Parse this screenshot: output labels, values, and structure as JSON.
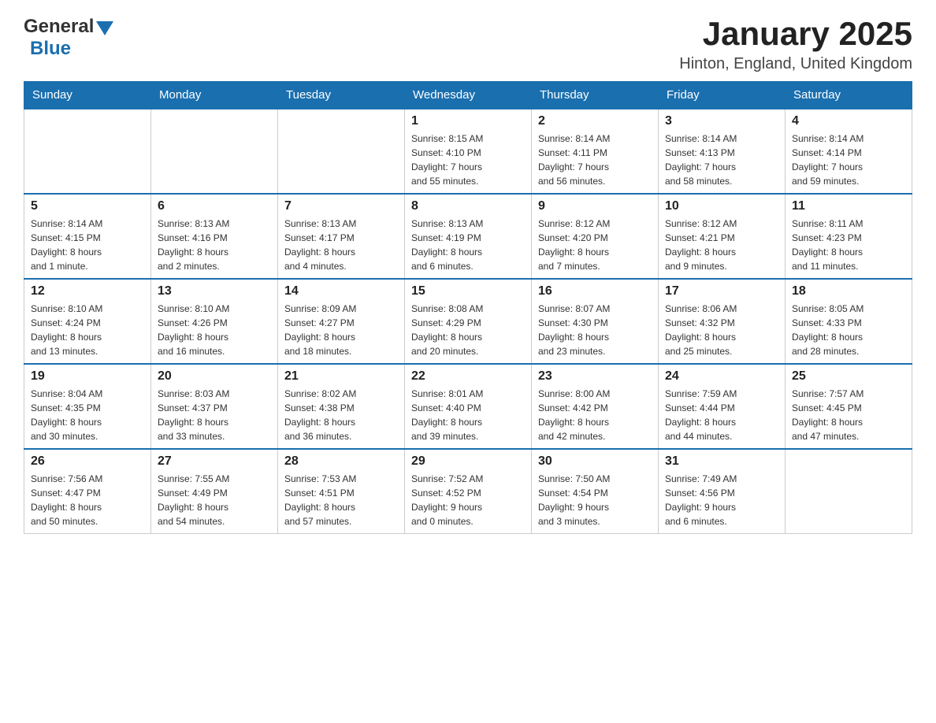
{
  "header": {
    "logo_text_general": "General",
    "logo_text_blue": "Blue",
    "title": "January 2025",
    "subtitle": "Hinton, England, United Kingdom"
  },
  "days_of_week": [
    "Sunday",
    "Monday",
    "Tuesday",
    "Wednesday",
    "Thursday",
    "Friday",
    "Saturday"
  ],
  "weeks": [
    [
      {
        "day": "",
        "info": ""
      },
      {
        "day": "",
        "info": ""
      },
      {
        "day": "",
        "info": ""
      },
      {
        "day": "1",
        "info": "Sunrise: 8:15 AM\nSunset: 4:10 PM\nDaylight: 7 hours\nand 55 minutes."
      },
      {
        "day": "2",
        "info": "Sunrise: 8:14 AM\nSunset: 4:11 PM\nDaylight: 7 hours\nand 56 minutes."
      },
      {
        "day": "3",
        "info": "Sunrise: 8:14 AM\nSunset: 4:13 PM\nDaylight: 7 hours\nand 58 minutes."
      },
      {
        "day": "4",
        "info": "Sunrise: 8:14 AM\nSunset: 4:14 PM\nDaylight: 7 hours\nand 59 minutes."
      }
    ],
    [
      {
        "day": "5",
        "info": "Sunrise: 8:14 AM\nSunset: 4:15 PM\nDaylight: 8 hours\nand 1 minute."
      },
      {
        "day": "6",
        "info": "Sunrise: 8:13 AM\nSunset: 4:16 PM\nDaylight: 8 hours\nand 2 minutes."
      },
      {
        "day": "7",
        "info": "Sunrise: 8:13 AM\nSunset: 4:17 PM\nDaylight: 8 hours\nand 4 minutes."
      },
      {
        "day": "8",
        "info": "Sunrise: 8:13 AM\nSunset: 4:19 PM\nDaylight: 8 hours\nand 6 minutes."
      },
      {
        "day": "9",
        "info": "Sunrise: 8:12 AM\nSunset: 4:20 PM\nDaylight: 8 hours\nand 7 minutes."
      },
      {
        "day": "10",
        "info": "Sunrise: 8:12 AM\nSunset: 4:21 PM\nDaylight: 8 hours\nand 9 minutes."
      },
      {
        "day": "11",
        "info": "Sunrise: 8:11 AM\nSunset: 4:23 PM\nDaylight: 8 hours\nand 11 minutes."
      }
    ],
    [
      {
        "day": "12",
        "info": "Sunrise: 8:10 AM\nSunset: 4:24 PM\nDaylight: 8 hours\nand 13 minutes."
      },
      {
        "day": "13",
        "info": "Sunrise: 8:10 AM\nSunset: 4:26 PM\nDaylight: 8 hours\nand 16 minutes."
      },
      {
        "day": "14",
        "info": "Sunrise: 8:09 AM\nSunset: 4:27 PM\nDaylight: 8 hours\nand 18 minutes."
      },
      {
        "day": "15",
        "info": "Sunrise: 8:08 AM\nSunset: 4:29 PM\nDaylight: 8 hours\nand 20 minutes."
      },
      {
        "day": "16",
        "info": "Sunrise: 8:07 AM\nSunset: 4:30 PM\nDaylight: 8 hours\nand 23 minutes."
      },
      {
        "day": "17",
        "info": "Sunrise: 8:06 AM\nSunset: 4:32 PM\nDaylight: 8 hours\nand 25 minutes."
      },
      {
        "day": "18",
        "info": "Sunrise: 8:05 AM\nSunset: 4:33 PM\nDaylight: 8 hours\nand 28 minutes."
      }
    ],
    [
      {
        "day": "19",
        "info": "Sunrise: 8:04 AM\nSunset: 4:35 PM\nDaylight: 8 hours\nand 30 minutes."
      },
      {
        "day": "20",
        "info": "Sunrise: 8:03 AM\nSunset: 4:37 PM\nDaylight: 8 hours\nand 33 minutes."
      },
      {
        "day": "21",
        "info": "Sunrise: 8:02 AM\nSunset: 4:38 PM\nDaylight: 8 hours\nand 36 minutes."
      },
      {
        "day": "22",
        "info": "Sunrise: 8:01 AM\nSunset: 4:40 PM\nDaylight: 8 hours\nand 39 minutes."
      },
      {
        "day": "23",
        "info": "Sunrise: 8:00 AM\nSunset: 4:42 PM\nDaylight: 8 hours\nand 42 minutes."
      },
      {
        "day": "24",
        "info": "Sunrise: 7:59 AM\nSunset: 4:44 PM\nDaylight: 8 hours\nand 44 minutes."
      },
      {
        "day": "25",
        "info": "Sunrise: 7:57 AM\nSunset: 4:45 PM\nDaylight: 8 hours\nand 47 minutes."
      }
    ],
    [
      {
        "day": "26",
        "info": "Sunrise: 7:56 AM\nSunset: 4:47 PM\nDaylight: 8 hours\nand 50 minutes."
      },
      {
        "day": "27",
        "info": "Sunrise: 7:55 AM\nSunset: 4:49 PM\nDaylight: 8 hours\nand 54 minutes."
      },
      {
        "day": "28",
        "info": "Sunrise: 7:53 AM\nSunset: 4:51 PM\nDaylight: 8 hours\nand 57 minutes."
      },
      {
        "day": "29",
        "info": "Sunrise: 7:52 AM\nSunset: 4:52 PM\nDaylight: 9 hours\nand 0 minutes."
      },
      {
        "day": "30",
        "info": "Sunrise: 7:50 AM\nSunset: 4:54 PM\nDaylight: 9 hours\nand 3 minutes."
      },
      {
        "day": "31",
        "info": "Sunrise: 7:49 AM\nSunset: 4:56 PM\nDaylight: 9 hours\nand 6 minutes."
      },
      {
        "day": "",
        "info": ""
      }
    ]
  ]
}
